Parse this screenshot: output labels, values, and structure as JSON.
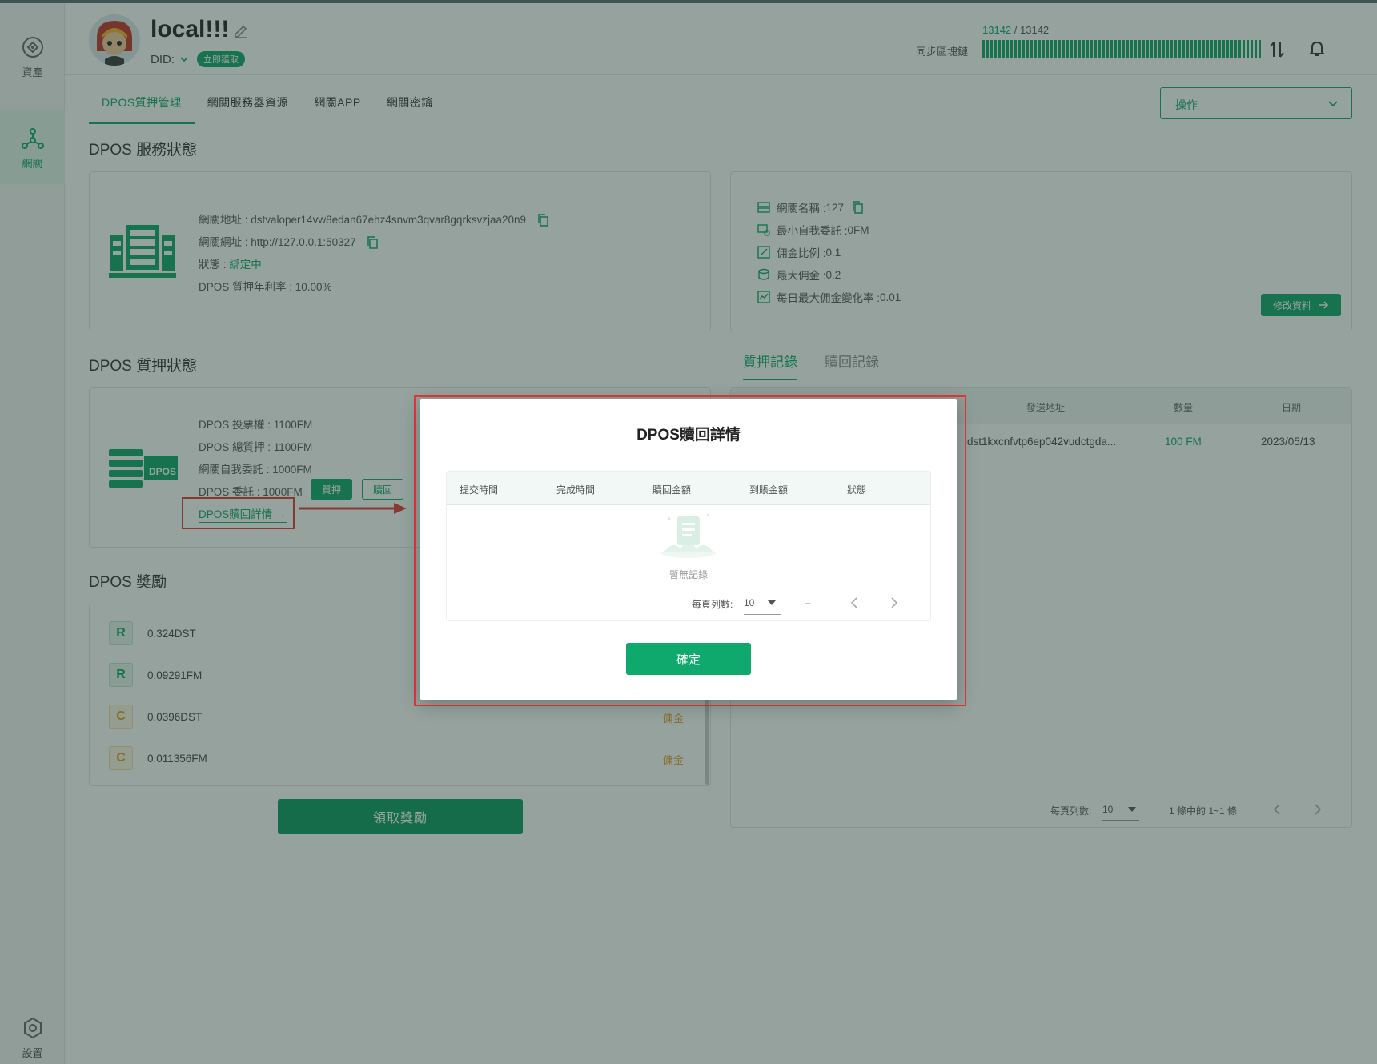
{
  "sidebar": {
    "items": [
      {
        "label": "資產",
        "icon": "wallet-icon"
      },
      {
        "label": "網關",
        "icon": "network-icon"
      },
      {
        "label": "設置",
        "icon": "settings-icon"
      }
    ]
  },
  "header": {
    "node_name": "local!!!",
    "did_label": "DID:",
    "did_badge": "立即獲取",
    "sync_current": "13142",
    "sync_sep": " / ",
    "sync_total": "13142",
    "sync_label": "同步區塊鏈",
    "sync_progress": 1.0
  },
  "tabs": [
    "DPOS質押管理",
    "網關服務器資源",
    "網關APP",
    "網關密鑰"
  ],
  "operation_select": {
    "value": "操作"
  },
  "service_status": {
    "title": "DPOS 服務狀態",
    "gateway_address_label": "網關地址 : ",
    "gateway_address": "dstvaloper14vw8edan67ehz4snvm3qvar8gqrksvzjaa20n9",
    "gateway_url_label": "網關網址 : ",
    "gateway_url": "http://127.0.0.1:50327",
    "status_label": "狀態 : ",
    "status_value": "綁定中",
    "apr_label": "DPOS 質押年利率 : ",
    "apr_value": "10.00%"
  },
  "gateway_info": {
    "name_label": "網關名稱 : ",
    "name_value": "127",
    "min_self_label": "最小自我委託 : ",
    "min_self_value": "0FM",
    "commission_label": "佣金比例 : ",
    "commission_value": "0.1",
    "max_commission_label": "最大佣金 : ",
    "max_commission_value": "0.2",
    "max_change_label": "每日最大佣金變化率 : ",
    "max_change_value": "0.01",
    "edit_button": "修改資料"
  },
  "pledge_status": {
    "title": "DPOS 質押狀態",
    "votes_label": "DPOS 投票權 : ",
    "votes_value": "1100FM",
    "total_label": "DPOS 總質押 : ",
    "total_value": "1100FM",
    "self_label": "網關自我委託 : ",
    "self_value": "1000FM",
    "delegate_label": "DPOS 委託 : ",
    "delegate_value": "1000FM",
    "pledge_button": "質押",
    "redeem_button": "贖回",
    "detail_link": "DPOS贖回詳情",
    "server_badge": "DPOS"
  },
  "records": {
    "tab_pledge": "質押記錄",
    "tab_redeem": "贖回記錄",
    "columns": [
      "發送地址",
      "數量",
      "日期"
    ],
    "rows": [
      {
        "address": "dst1kxcnfvtp6ep042vudctgda...",
        "amount": "100 FM",
        "date": "2023/05/13"
      }
    ],
    "pager": {
      "per_page_label": "每頁列數:",
      "per_page": "10",
      "range": "1 條中的 1~1 條"
    }
  },
  "rewards": {
    "title": "DPOS 獎勵",
    "items": [
      {
        "badge": "R",
        "amount": "0.324DST",
        "tag": ""
      },
      {
        "badge": "R",
        "amount": "0.09291FM",
        "tag": ""
      },
      {
        "badge": "C",
        "amount": "0.0396DST",
        "tag": "傭金"
      },
      {
        "badge": "C",
        "amount": "0.011356FM",
        "tag": "傭金"
      }
    ],
    "claim_button": "領取獎勵"
  },
  "modal": {
    "title": "DPOS贖回詳情",
    "columns": [
      "提交時間",
      "完成時間",
      "贖回金額",
      "到賬金額",
      "狀態"
    ],
    "empty_text": "暫無記錄",
    "pager": {
      "per_page_label": "每頁列數:",
      "per_page": "10",
      "range": "–"
    },
    "confirm_button": "確定"
  },
  "colors": {
    "accent": "#10a56c",
    "commission": "#e69b2e",
    "highlight": "#e53935"
  }
}
